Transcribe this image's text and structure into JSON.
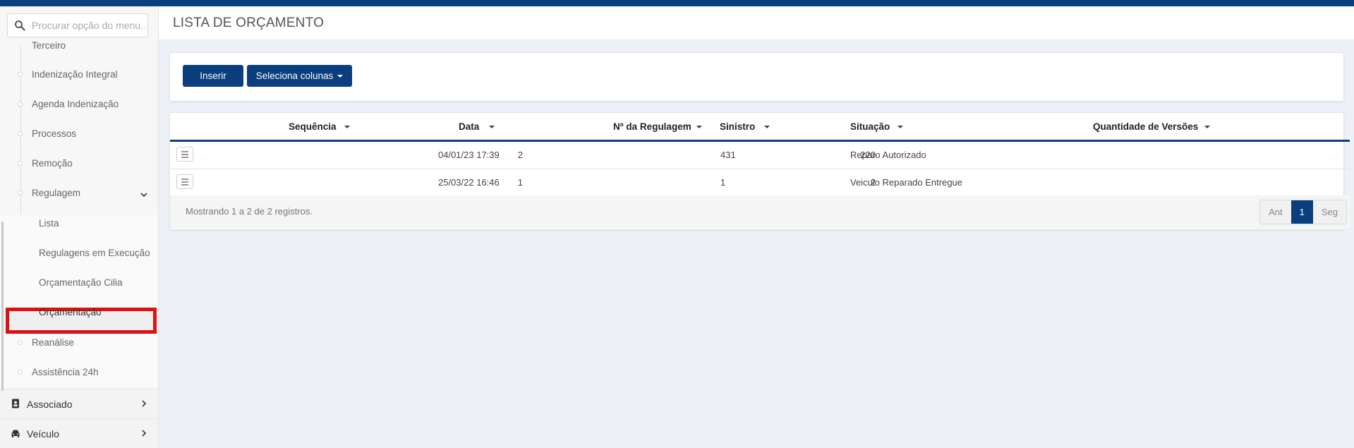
{
  "colors": {
    "primary": "#0a3e7d",
    "highlight": "#e01010"
  },
  "search": {
    "placeholder": "Procurar opção do menu..."
  },
  "sidebar": {
    "items": [
      {
        "label": "Terceiro"
      },
      {
        "label": "Indenização Integral"
      },
      {
        "label": "Agenda Indenização"
      },
      {
        "label": "Processos"
      },
      {
        "label": "Remoção"
      },
      {
        "label": "Regulagem",
        "expanded": true
      }
    ],
    "subitems": [
      {
        "label": "Lista"
      },
      {
        "label": "Regulagens em Execução"
      },
      {
        "label": "Orçamentação Cilia"
      },
      {
        "label": "Orçamentação",
        "selected": true
      }
    ],
    "items_after": [
      {
        "label": "Reanálise"
      },
      {
        "label": "Assistência 24h"
      }
    ],
    "sections": [
      {
        "label": "Associado",
        "icon": "id-card-icon"
      },
      {
        "label": "Veículo",
        "icon": "car-icon"
      }
    ]
  },
  "page": {
    "title": "LISTA DE ORÇAMENTO"
  },
  "toolbar": {
    "insert_label": "Inserir",
    "columns_label": "Seleciona colunas"
  },
  "table": {
    "columns": [
      "Sequência",
      "Data",
      "Nº da Regulagem",
      "Sinistro",
      "Situação",
      "Quantidade de Versões"
    ],
    "rows": [
      {
        "sequencia": "2",
        "data": "04/01/23 17:39",
        "regulagem": "220",
        "sinistro": "431",
        "situacao": "Reparo Autorizado",
        "versoes": ""
      },
      {
        "sequencia": "1",
        "data": "25/03/22 16:46",
        "regulagem": "2",
        "sinistro": "1",
        "situacao": "Veiculo Reparado Entregue",
        "versoes": ""
      }
    ],
    "info": "Mostrando 1 a 2 de 2 registros."
  },
  "pagination": {
    "prev": "Ant",
    "current": "1",
    "next": "Seg"
  }
}
